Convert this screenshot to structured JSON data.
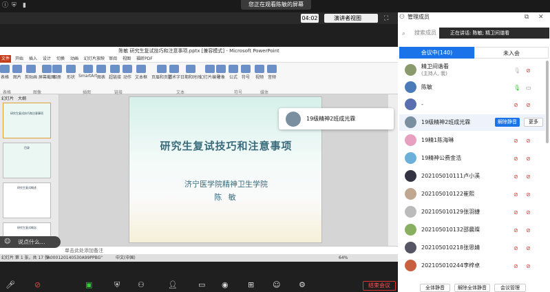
{
  "banner": "您正在观看陈敏的屏幕",
  "toolbar": {
    "timer": "04:02",
    "presenter_view": "演讲者视图"
  },
  "ppt": {
    "window_title": "陈敏 研究生复试技巧和注意事项.pptx [兼容模式] - Microsoft PowerPoint",
    "tabs": [
      "文件",
      "开始",
      "插入",
      "设计",
      "切换",
      "动画",
      "幻灯片放映",
      "审阅",
      "视图",
      "福昕PDF"
    ],
    "ribbon_buttons": [
      "表格",
      "图片",
      "剪贴画",
      "屏幕截图",
      "相册",
      "形状",
      "SmartArt",
      "图表",
      "超链接",
      "动作",
      "文本框",
      "页眉和页脚",
      "艺术字",
      "日期和时间",
      "幻灯片编号",
      "对象",
      "公式",
      "符号",
      "视频",
      "音频"
    ],
    "groups": [
      "表格",
      "图像",
      "插图",
      "链接",
      "文本",
      "符号",
      "媒体"
    ],
    "panel_tabs": [
      "幻灯片",
      "大纲"
    ],
    "thumbs": [
      "研究生复试技巧和注意事项",
      "目录",
      "研究生复试概述",
      "研究生复试概念"
    ],
    "slide": {
      "title": "研究生复试技巧和注意事项",
      "subtitle": "济宁医学院精神卫生学院",
      "name": "陈 敏"
    },
    "notes_placeholder": "单击此处添加备注",
    "status": {
      "left": "幻灯片 第 1 张，共 17 张",
      "theme": "\"A000120140530A99PPBG\"",
      "lang": "中文(中国)",
      "zoom": "64%"
    }
  },
  "popup": {
    "name": "19级精神2班成光霖"
  },
  "chat_pill": "说点什么...",
  "leave": "结束会议",
  "sidebar": {
    "title": "管理成员",
    "search_placeholder": "搜索成员",
    "speaking": "正在讲话: 陈敏; 精卫间谐看",
    "tab_in": "会议中(140)",
    "tab_out": "未入会",
    "members": [
      {
        "name": "精卫间谐看",
        "role": "(主持人, 我)",
        "color": "#8a9a6a"
      },
      {
        "name": "陈敏",
        "role": "",
        "color": "#4a7ab8"
      },
      {
        "name": "-",
        "role": "",
        "color": "#5a6fb0"
      },
      {
        "name": "19级精神2班成光霖",
        "role": "",
        "color": "#7a8fa0"
      },
      {
        "name": "19精1陈海琳",
        "role": "",
        "color": "#e8a0c0"
      },
      {
        "name": "19精神公费金浩",
        "role": "",
        "color": "#6ab0d8"
      },
      {
        "name": "202105010111卢小溪",
        "role": "",
        "color": "#334"
      },
      {
        "name": "202105010122崔熙",
        "role": "",
        "color": "#c0a890"
      },
      {
        "name": "202105010129张羽捷",
        "role": "",
        "color": "#bbb"
      },
      {
        "name": "202105010132邵晨璨",
        "role": "",
        "color": "#88b060"
      },
      {
        "name": "202105010218张思婧",
        "role": "",
        "color": "#556"
      },
      {
        "name": "202105010244李梓卓",
        "role": "",
        "color": "#c86040"
      }
    ],
    "unmute": "解除静音",
    "more": "更多",
    "mute_all": "全体静音",
    "unmute_all": "解除全体静音",
    "mgmt": "会议管理"
  }
}
